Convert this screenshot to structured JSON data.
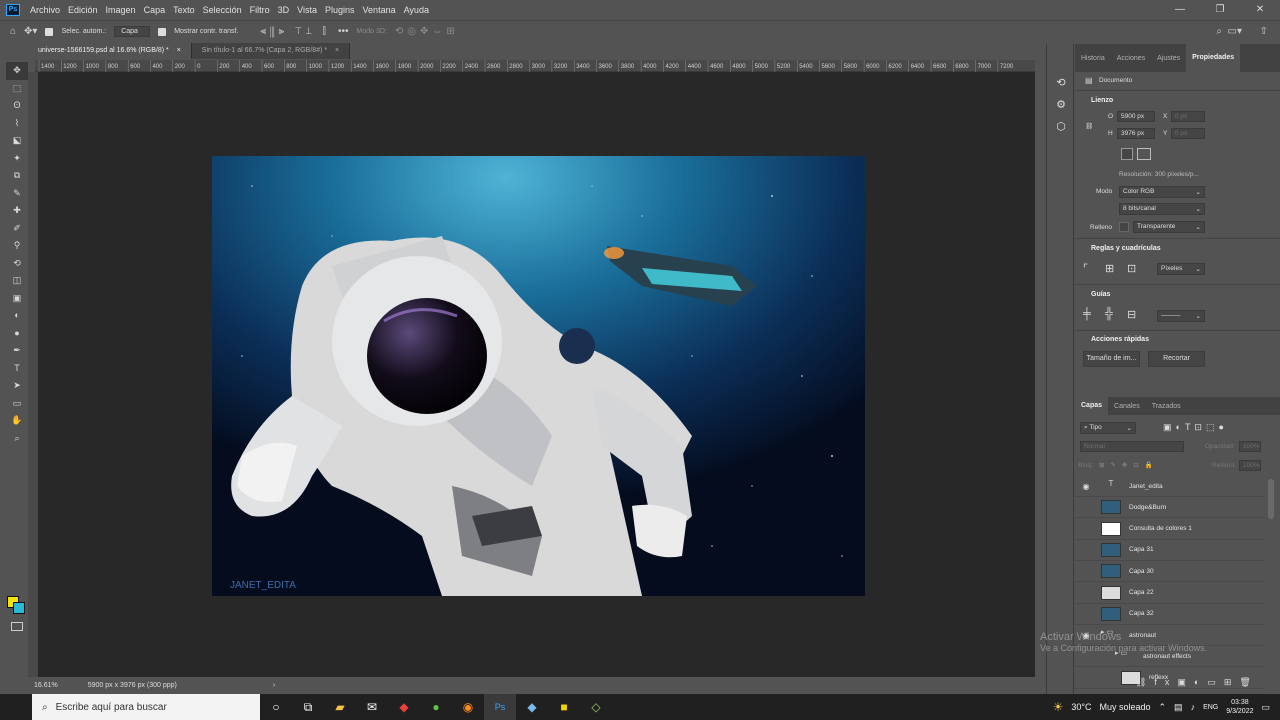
{
  "menubar": {
    "items": [
      "Archivo",
      "Edición",
      "Imagen",
      "Capa",
      "Texto",
      "Selección",
      "Filtro",
      "3D",
      "Vista",
      "Plugins",
      "Ventana",
      "Ayuda"
    ],
    "logo": "Ps",
    "window_controls": [
      "—",
      "❐",
      "✕"
    ]
  },
  "options": {
    "auto_select_label": "Selec. autom.:",
    "auto_select_value": "Capa",
    "show_transform_label": "Mostrar contr. transf.",
    "mode3d_label": "Modo 3D:",
    "more_icon": "•••"
  },
  "tabs": [
    {
      "label": "universe-1566159.psd al 16.6% (RGB/8) *",
      "close": "×"
    },
    {
      "label": "Sin título-1 al 66.7% (Capa 2, RGB/8#) *",
      "close": "×"
    }
  ],
  "ruler": {
    "labels": [
      "1400",
      "1200",
      "1000",
      "800",
      "600",
      "400",
      "200",
      "0",
      "200",
      "400",
      "600",
      "800",
      "1000",
      "1200",
      "1400",
      "1600",
      "1800",
      "2000",
      "2200",
      "2400",
      "2600",
      "2800",
      "3000",
      "3200",
      "3400",
      "3600",
      "3800",
      "4000",
      "4200",
      "4400",
      "4600",
      "4800",
      "5000",
      "5200",
      "5400",
      "5600",
      "5800",
      "6000",
      "6200",
      "6400",
      "6600",
      "6800",
      "7000",
      "7200"
    ]
  },
  "toolbar": {
    "tools": [
      "move-tool",
      "marquee-tool",
      "lasso-tool",
      "polygonal-lasso-tool",
      "object-select-tool",
      "magic-wand-tool",
      "crop-tool",
      "eyedropper-tool",
      "spot-healing-tool",
      "brush-tool",
      "stamp-tool",
      "history-brush-tool",
      "eraser-tool",
      "gradient-tool",
      "blur-tool",
      "dodge-tool",
      "pen-tool",
      "type-tool",
      "path-select-tool",
      "shape-tool",
      "hand-tool",
      "zoom-tool"
    ],
    "glyphs": [
      "✥",
      "⬚",
      "ʘ",
      "⌇",
      "⬕",
      "✦",
      "⧉",
      "✎",
      "✚",
      "✐",
      "⚲",
      "⟲",
      "◫",
      "▣",
      "◐",
      "●",
      "✒",
      "T",
      "➤",
      "▭",
      "✋",
      "⌕"
    ],
    "fg_color": "#f5e400",
    "bg_color": "#28b8d8"
  },
  "canvas": {
    "watermark_text": "JANET_EDITA"
  },
  "statusbar": {
    "zoom": "16.61%",
    "doc_info": "5900 px x 3976 px (300 ppp)",
    "arrow": "›"
  },
  "properties": {
    "tabs": [
      "Historia",
      "Acciones",
      "Ajustes",
      "Propiedades"
    ],
    "doc_label": "Documento",
    "lienzo": {
      "title": "Lienzo",
      "w_label": "O",
      "w_value": "5900 px",
      "x_label": "X",
      "x_value": "0 px",
      "h_label": "H",
      "h_value": "3976 px",
      "y_label": "Y",
      "y_value": "0 px",
      "resolution": "Resolución: 300 píxeles/p...",
      "mode_label": "Modo",
      "mode_value": "Color RGB",
      "bits_value": "8 bits/canal",
      "fill_label": "Relleno",
      "fill_value": "Transparente"
    },
    "rulers": {
      "title": "Reglas y cuadrículas",
      "unit": "Píxeles"
    },
    "guides": {
      "title": "Guías"
    },
    "quick": {
      "title": "Acciones rápidas",
      "btn1": "Tamaño de im...",
      "btn2": "Recortar"
    }
  },
  "layers": {
    "tabs": [
      "Capas",
      "Canales",
      "Trazados"
    ],
    "filter": "Tipo",
    "blend": "Normal",
    "opacity_label": "Opacidad:",
    "opacity": "100%",
    "lock_label": "Bloq.:",
    "fill_label": "Relleno:",
    "fill": "100%",
    "items": [
      {
        "name": "Janet_edita",
        "kind": "type",
        "visible": true
      },
      {
        "name": "Dodge&Burn",
        "kind": "image",
        "visible": false
      },
      {
        "name": "Consulta de colores 1",
        "kind": "adjust",
        "visible": false
      },
      {
        "name": "Capa 31",
        "kind": "image",
        "visible": false
      },
      {
        "name": "Capa 30",
        "kind": "image",
        "visible": false
      },
      {
        "name": "Capa 22",
        "kind": "transparent",
        "visible": false
      },
      {
        "name": "Capa 32",
        "kind": "image",
        "visible": false
      },
      {
        "name": "astronaut",
        "kind": "group",
        "visible": true
      },
      {
        "name": "astronaut effects",
        "kind": "group",
        "visible": false
      },
      {
        "name": "reflexx",
        "kind": "masked",
        "visible": false
      }
    ]
  },
  "windows_watermark": {
    "line1": "Activar Windows",
    "line2": "Ve a Configuración para activar Windows."
  },
  "taskbar": {
    "search_placeholder": "Escribe aquí para buscar",
    "weather_temp": "30°C",
    "weather_desc": "Muy soleado",
    "lang": "ENG",
    "time": "03:38",
    "date": "9/3/2022"
  }
}
